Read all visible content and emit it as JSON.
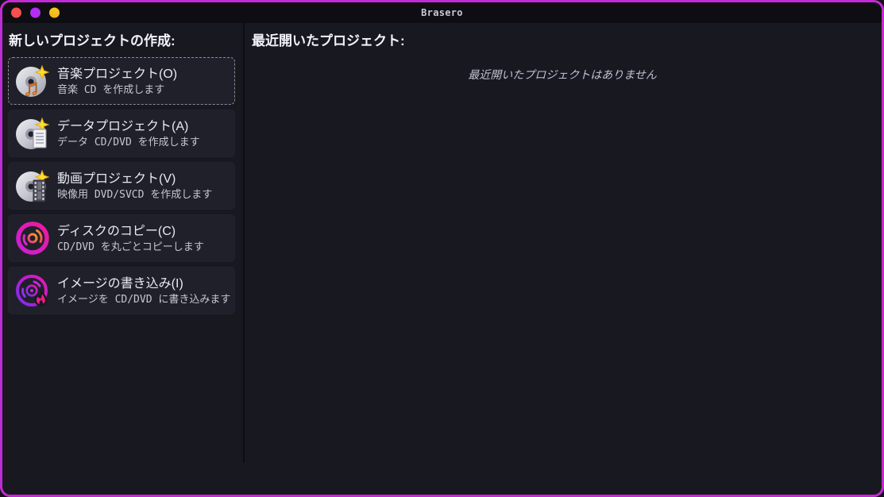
{
  "window": {
    "title": "Brasero",
    "border_color": "#c32bd2",
    "titlebar_bg": "#0d0d13",
    "content_bg": "#181821",
    "traffic_lights": {
      "close_color": "#f9504e",
      "minimize_color": "#b32df2",
      "maximize_color": "#f7c51d"
    }
  },
  "left_panel": {
    "header": "新しいプロジェクトの作成:",
    "projects": [
      {
        "icon": "audio-cd-icon",
        "title": "音楽プロジェクト(O)",
        "subtitle": "音楽 CD を作成します"
      },
      {
        "icon": "data-cd-icon",
        "title": "データプロジェクト(A)",
        "subtitle": "データ CD/DVD を作成します"
      },
      {
        "icon": "video-cd-icon",
        "title": "動画プロジェクト(V)",
        "subtitle": "映像用 DVD/SVCD を作成します"
      },
      {
        "icon": "disc-copy-icon",
        "title": "ディスクのコピー(C)",
        "subtitle": "CD/DVD を丸ごとコピーします"
      },
      {
        "icon": "burn-image-icon",
        "title": "イメージの書き込み(I)",
        "subtitle": "イメージを CD/DVD に書き込みます"
      }
    ]
  },
  "right_panel": {
    "header": "最近開いたプロジェクト:",
    "empty_message": "最近開いたプロジェクトはありません"
  },
  "accent_colors": {
    "disc_magenta": "#ee189e",
    "disc_purple": "#7a2cf2",
    "note_orange": "#f49030",
    "star_yellow": "#fadf2e",
    "flame_pink": "#ee1b86"
  }
}
